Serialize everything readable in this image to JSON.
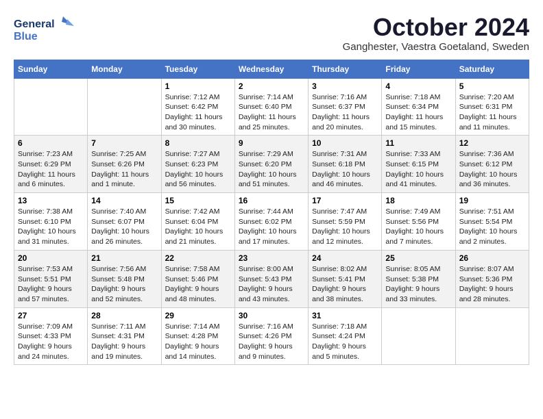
{
  "header": {
    "logo_line1": "General",
    "logo_line2": "Blue",
    "month": "October 2024",
    "location": "Ganghester, Vaestra Goetaland, Sweden"
  },
  "weekdays": [
    "Sunday",
    "Monday",
    "Tuesday",
    "Wednesday",
    "Thursday",
    "Friday",
    "Saturday"
  ],
  "weeks": [
    [
      {
        "day": "",
        "sunrise": "",
        "sunset": "",
        "daylight": ""
      },
      {
        "day": "",
        "sunrise": "",
        "sunset": "",
        "daylight": ""
      },
      {
        "day": "1",
        "sunrise": "Sunrise: 7:12 AM",
        "sunset": "Sunset: 6:42 PM",
        "daylight": "Daylight: 11 hours and 30 minutes."
      },
      {
        "day": "2",
        "sunrise": "Sunrise: 7:14 AM",
        "sunset": "Sunset: 6:40 PM",
        "daylight": "Daylight: 11 hours and 25 minutes."
      },
      {
        "day": "3",
        "sunrise": "Sunrise: 7:16 AM",
        "sunset": "Sunset: 6:37 PM",
        "daylight": "Daylight: 11 hours and 20 minutes."
      },
      {
        "day": "4",
        "sunrise": "Sunrise: 7:18 AM",
        "sunset": "Sunset: 6:34 PM",
        "daylight": "Daylight: 11 hours and 15 minutes."
      },
      {
        "day": "5",
        "sunrise": "Sunrise: 7:20 AM",
        "sunset": "Sunset: 6:31 PM",
        "daylight": "Daylight: 11 hours and 11 minutes."
      }
    ],
    [
      {
        "day": "6",
        "sunrise": "Sunrise: 7:23 AM",
        "sunset": "Sunset: 6:29 PM",
        "daylight": "Daylight: 11 hours and 6 minutes."
      },
      {
        "day": "7",
        "sunrise": "Sunrise: 7:25 AM",
        "sunset": "Sunset: 6:26 PM",
        "daylight": "Daylight: 11 hours and 1 minute."
      },
      {
        "day": "8",
        "sunrise": "Sunrise: 7:27 AM",
        "sunset": "Sunset: 6:23 PM",
        "daylight": "Daylight: 10 hours and 56 minutes."
      },
      {
        "day": "9",
        "sunrise": "Sunrise: 7:29 AM",
        "sunset": "Sunset: 6:20 PM",
        "daylight": "Daylight: 10 hours and 51 minutes."
      },
      {
        "day": "10",
        "sunrise": "Sunrise: 7:31 AM",
        "sunset": "Sunset: 6:18 PM",
        "daylight": "Daylight: 10 hours and 46 minutes."
      },
      {
        "day": "11",
        "sunrise": "Sunrise: 7:33 AM",
        "sunset": "Sunset: 6:15 PM",
        "daylight": "Daylight: 10 hours and 41 minutes."
      },
      {
        "day": "12",
        "sunrise": "Sunrise: 7:36 AM",
        "sunset": "Sunset: 6:12 PM",
        "daylight": "Daylight: 10 hours and 36 minutes."
      }
    ],
    [
      {
        "day": "13",
        "sunrise": "Sunrise: 7:38 AM",
        "sunset": "Sunset: 6:10 PM",
        "daylight": "Daylight: 10 hours and 31 minutes."
      },
      {
        "day": "14",
        "sunrise": "Sunrise: 7:40 AM",
        "sunset": "Sunset: 6:07 PM",
        "daylight": "Daylight: 10 hours and 26 minutes."
      },
      {
        "day": "15",
        "sunrise": "Sunrise: 7:42 AM",
        "sunset": "Sunset: 6:04 PM",
        "daylight": "Daylight: 10 hours and 21 minutes."
      },
      {
        "day": "16",
        "sunrise": "Sunrise: 7:44 AM",
        "sunset": "Sunset: 6:02 PM",
        "daylight": "Daylight: 10 hours and 17 minutes."
      },
      {
        "day": "17",
        "sunrise": "Sunrise: 7:47 AM",
        "sunset": "Sunset: 5:59 PM",
        "daylight": "Daylight: 10 hours and 12 minutes."
      },
      {
        "day": "18",
        "sunrise": "Sunrise: 7:49 AM",
        "sunset": "Sunset: 5:56 PM",
        "daylight": "Daylight: 10 hours and 7 minutes."
      },
      {
        "day": "19",
        "sunrise": "Sunrise: 7:51 AM",
        "sunset": "Sunset: 5:54 PM",
        "daylight": "Daylight: 10 hours and 2 minutes."
      }
    ],
    [
      {
        "day": "20",
        "sunrise": "Sunrise: 7:53 AM",
        "sunset": "Sunset: 5:51 PM",
        "daylight": "Daylight: 9 hours and 57 minutes."
      },
      {
        "day": "21",
        "sunrise": "Sunrise: 7:56 AM",
        "sunset": "Sunset: 5:48 PM",
        "daylight": "Daylight: 9 hours and 52 minutes."
      },
      {
        "day": "22",
        "sunrise": "Sunrise: 7:58 AM",
        "sunset": "Sunset: 5:46 PM",
        "daylight": "Daylight: 9 hours and 48 minutes."
      },
      {
        "day": "23",
        "sunrise": "Sunrise: 8:00 AM",
        "sunset": "Sunset: 5:43 PM",
        "daylight": "Daylight: 9 hours and 43 minutes."
      },
      {
        "day": "24",
        "sunrise": "Sunrise: 8:02 AM",
        "sunset": "Sunset: 5:41 PM",
        "daylight": "Daylight: 9 hours and 38 minutes."
      },
      {
        "day": "25",
        "sunrise": "Sunrise: 8:05 AM",
        "sunset": "Sunset: 5:38 PM",
        "daylight": "Daylight: 9 hours and 33 minutes."
      },
      {
        "day": "26",
        "sunrise": "Sunrise: 8:07 AM",
        "sunset": "Sunset: 5:36 PM",
        "daylight": "Daylight: 9 hours and 28 minutes."
      }
    ],
    [
      {
        "day": "27",
        "sunrise": "Sunrise: 7:09 AM",
        "sunset": "Sunset: 4:33 PM",
        "daylight": "Daylight: 9 hours and 24 minutes."
      },
      {
        "day": "28",
        "sunrise": "Sunrise: 7:11 AM",
        "sunset": "Sunset: 4:31 PM",
        "daylight": "Daylight: 9 hours and 19 minutes."
      },
      {
        "day": "29",
        "sunrise": "Sunrise: 7:14 AM",
        "sunset": "Sunset: 4:28 PM",
        "daylight": "Daylight: 9 hours and 14 minutes."
      },
      {
        "day": "30",
        "sunrise": "Sunrise: 7:16 AM",
        "sunset": "Sunset: 4:26 PM",
        "daylight": "Daylight: 9 hours and 9 minutes."
      },
      {
        "day": "31",
        "sunrise": "Sunrise: 7:18 AM",
        "sunset": "Sunset: 4:24 PM",
        "daylight": "Daylight: 9 hours and 5 minutes."
      },
      {
        "day": "",
        "sunrise": "",
        "sunset": "",
        "daylight": ""
      },
      {
        "day": "",
        "sunrise": "",
        "sunset": "",
        "daylight": ""
      }
    ]
  ]
}
